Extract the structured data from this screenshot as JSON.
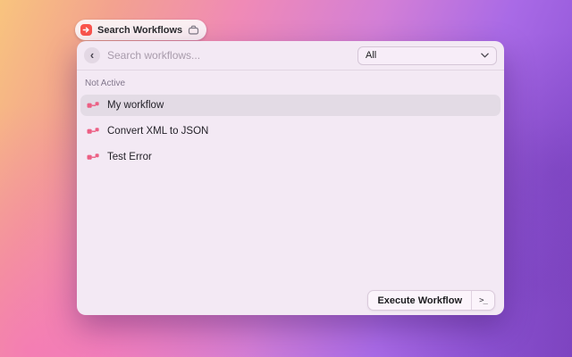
{
  "tooltip": {
    "label": "Search Workflows",
    "app_icon": "red-workflow-app-icon",
    "trailing_icon": "briefcase-icon"
  },
  "window": {
    "search": {
      "placeholder": "Search workflows..."
    },
    "filter": {
      "value": "All"
    },
    "section": {
      "title": "Not Active"
    },
    "items": [
      {
        "label": "My workflow",
        "selected": true
      },
      {
        "label": "Convert XML to JSON",
        "selected": false
      },
      {
        "label": "Test Error",
        "selected": false
      }
    ],
    "footer": {
      "execute_label": "Execute Workflow",
      "shortcut": ">_"
    }
  },
  "colors": {
    "workflow_icon": "#ec5f84",
    "app_badge": "#fb554d",
    "window_bg": "#f3e9f4",
    "selected_row_bg": "#e3dbe5",
    "accent_gradient": [
      "#f8c47e",
      "#f08ab6",
      "#8348c6"
    ]
  }
}
